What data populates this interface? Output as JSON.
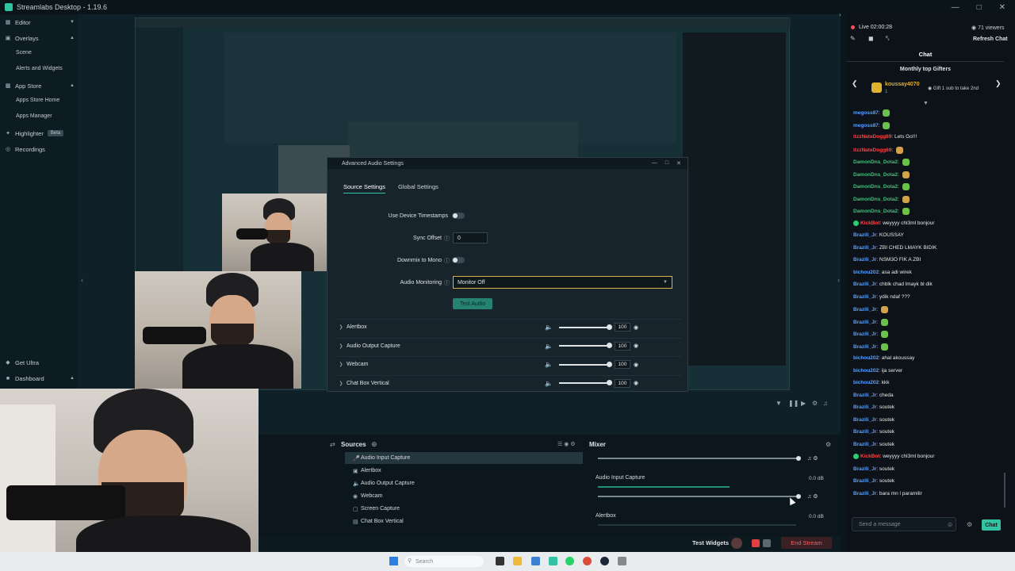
{
  "window": {
    "title": "Streamlabs Desktop - 1.19.6"
  },
  "nav": {
    "editor": "Editor",
    "overlays": "Overlays",
    "scene": "Scene",
    "alerts_widgets": "Alerts and Widgets",
    "app_store": "App Store",
    "apps_store_home": "Apps Store Home",
    "apps_manager": "Apps Manager",
    "highlighter": "Highlighter",
    "highlighter_badge": "Beta",
    "recordings": "Recordings",
    "get_ultra": "Get Ultra",
    "dashboard": "Dashboard"
  },
  "dialog": {
    "title": "Advanced Audio Settings",
    "tabs": [
      "Source Settings",
      "Global Settings"
    ],
    "use_device_timestamps": "Use Device Timestamps",
    "sync_offset_label": "Sync Offset",
    "sync_offset_value": "0",
    "downmix_label": "Downmix to Mono",
    "audio_monitoring_label": "Audio Monitoring",
    "audio_monitoring_value": "Monitor Off",
    "test_audio": "Test Audio",
    "sources": [
      {
        "name": "Alertbox",
        "volume": "100",
        "level": 1.0
      },
      {
        "name": "Audio Output Capture",
        "volume": "100",
        "level": 1.0
      },
      {
        "name": "Webcam",
        "volume": "100",
        "level": 1.0
      },
      {
        "name": "Chat Box Vertical",
        "volume": "100",
        "level": 1.0
      }
    ]
  },
  "sources_dock": {
    "title": "Sources",
    "items": [
      "Audio Input Capture",
      "Alertbox",
      "Audio Output Capture",
      "Webcam",
      "Screen Capture",
      "Chat Box Vertical"
    ]
  },
  "mixer_dock": {
    "title": "Mixer",
    "channels": [
      {
        "name": "Audio Input Capture",
        "db": "0.0 dB"
      },
      {
        "name": "Alertbox",
        "db": "0.0 dB"
      }
    ]
  },
  "footer": {
    "test_widgets": "Test Widgets",
    "end_stream": "End Stream"
  },
  "taskbar": {
    "search": "Search"
  },
  "stream": {
    "live_time": "Live 02:00:28",
    "viewers": "71 viewers",
    "refresh_chat": "Refresh Chat",
    "chat_tab": "Chat",
    "gifters_title": "Monthly top Gifters",
    "gifter_name": "koussay4070",
    "gifter_count": "1",
    "gift_text": "Gift 1 sub to take 2nd",
    "send_placeholder": "Send a message",
    "chat_button": "Chat"
  },
  "chat": [
    {
      "user": "megoss87",
      "text": "",
      "color": "#5aa0ff",
      "emote": "frog"
    },
    {
      "user": "megoss87",
      "text": "",
      "color": "#5aa0ff",
      "emote": "frog"
    },
    {
      "user": "itzzNateDogg69",
      "text": "Lets Go!!!",
      "color": "#ff4444",
      "emote": ""
    },
    {
      "user": "itzzNateDogg69",
      "text": "",
      "color": "#ff4444",
      "emote": "cat"
    },
    {
      "user": "DamonDns_Dota2",
      "text": "",
      "color": "#2ecc71",
      "emote": "frog"
    },
    {
      "user": "DamonDns_Dota2",
      "text": "",
      "color": "#2ecc71",
      "emote": "cat"
    },
    {
      "user": "DamonDns_Dota2",
      "text": "",
      "color": "#2ecc71",
      "emote": "frog"
    },
    {
      "user": "DamonDns_Dota2",
      "text": "",
      "color": "#2ecc71",
      "emote": "cat"
    },
    {
      "user": "DamonDns_Dota2",
      "text": "",
      "color": "#2ecc71",
      "emote": "frog"
    },
    {
      "user": "KickBot",
      "text": "weyyyy chl3ml bonjour",
      "color": "#ff4444",
      "emote": ""
    },
    {
      "user": "Brazili_Jr",
      "text": "KOUSSAY",
      "color": "#5aa0ff",
      "emote": ""
    },
    {
      "user": "Brazili_Jr",
      "text": "ZBI CHED LMAYK BIDIK",
      "color": "#5aa0ff",
      "emote": ""
    },
    {
      "user": "Brazili_Jr",
      "text": "NSM3O FIK A ZBI",
      "color": "#5aa0ff",
      "emote": ""
    },
    {
      "user": "bichou202",
      "text": "asa adi wirek",
      "color": "#5aa0ff",
      "emote": ""
    },
    {
      "user": "Brazili_Jr",
      "text": "chblk chad lmayk bl dik",
      "color": "#5aa0ff",
      "emote": ""
    },
    {
      "user": "Brazili_Jr",
      "text": "ydik ndaf ???",
      "color": "#5aa0ff",
      "emote": ""
    },
    {
      "user": "Brazili_Jr",
      "text": "",
      "color": "#5aa0ff",
      "emote": "cat"
    },
    {
      "user": "Brazili_Jr",
      "text": "",
      "color": "#5aa0ff",
      "emote": "frog"
    },
    {
      "user": "Brazili_Jr",
      "text": "",
      "color": "#5aa0ff",
      "emote": "frog"
    },
    {
      "user": "Brazili_Jr",
      "text": "",
      "color": "#5aa0ff",
      "emote": "frog"
    },
    {
      "user": "bichou202",
      "text": "ahal akoussay",
      "color": "#5aa0ff",
      "emote": ""
    },
    {
      "user": "bichou202",
      "text": "ija server",
      "color": "#5aa0ff",
      "emote": ""
    },
    {
      "user": "bichou202",
      "text": "kkk",
      "color": "#5aa0ff",
      "emote": ""
    },
    {
      "user": "Brazili_Jr",
      "text": "cheda",
      "color": "#5aa0ff",
      "emote": ""
    },
    {
      "user": "Brazili_Jr",
      "text": "soutek",
      "color": "#5aa0ff",
      "emote": ""
    },
    {
      "user": "Brazili_Jr",
      "text": "soutek",
      "color": "#5aa0ff",
      "emote": ""
    },
    {
      "user": "Brazili_Jr",
      "text": "soutek",
      "color": "#5aa0ff",
      "emote": ""
    },
    {
      "user": "Brazili_Jr",
      "text": "soutek",
      "color": "#5aa0ff",
      "emote": ""
    },
    {
      "user": "KickBot",
      "text": "weyyyy chl3ml bonjour",
      "color": "#ff4444",
      "emote": ""
    },
    {
      "user": "Brazili_Jr",
      "text": "soutek",
      "color": "#5aa0ff",
      "emote": ""
    },
    {
      "user": "Brazili_Jr",
      "text": "soutek",
      "color": "#5aa0ff",
      "emote": ""
    },
    {
      "user": "Brazili_Jr",
      "text": "bara mn l paramilir",
      "color": "#5aa0ff",
      "emote": ""
    }
  ],
  "colors": {
    "accent": "#31c3a2",
    "end_stream": "#ff4d4d",
    "live_dot": "#ff4d4d"
  }
}
